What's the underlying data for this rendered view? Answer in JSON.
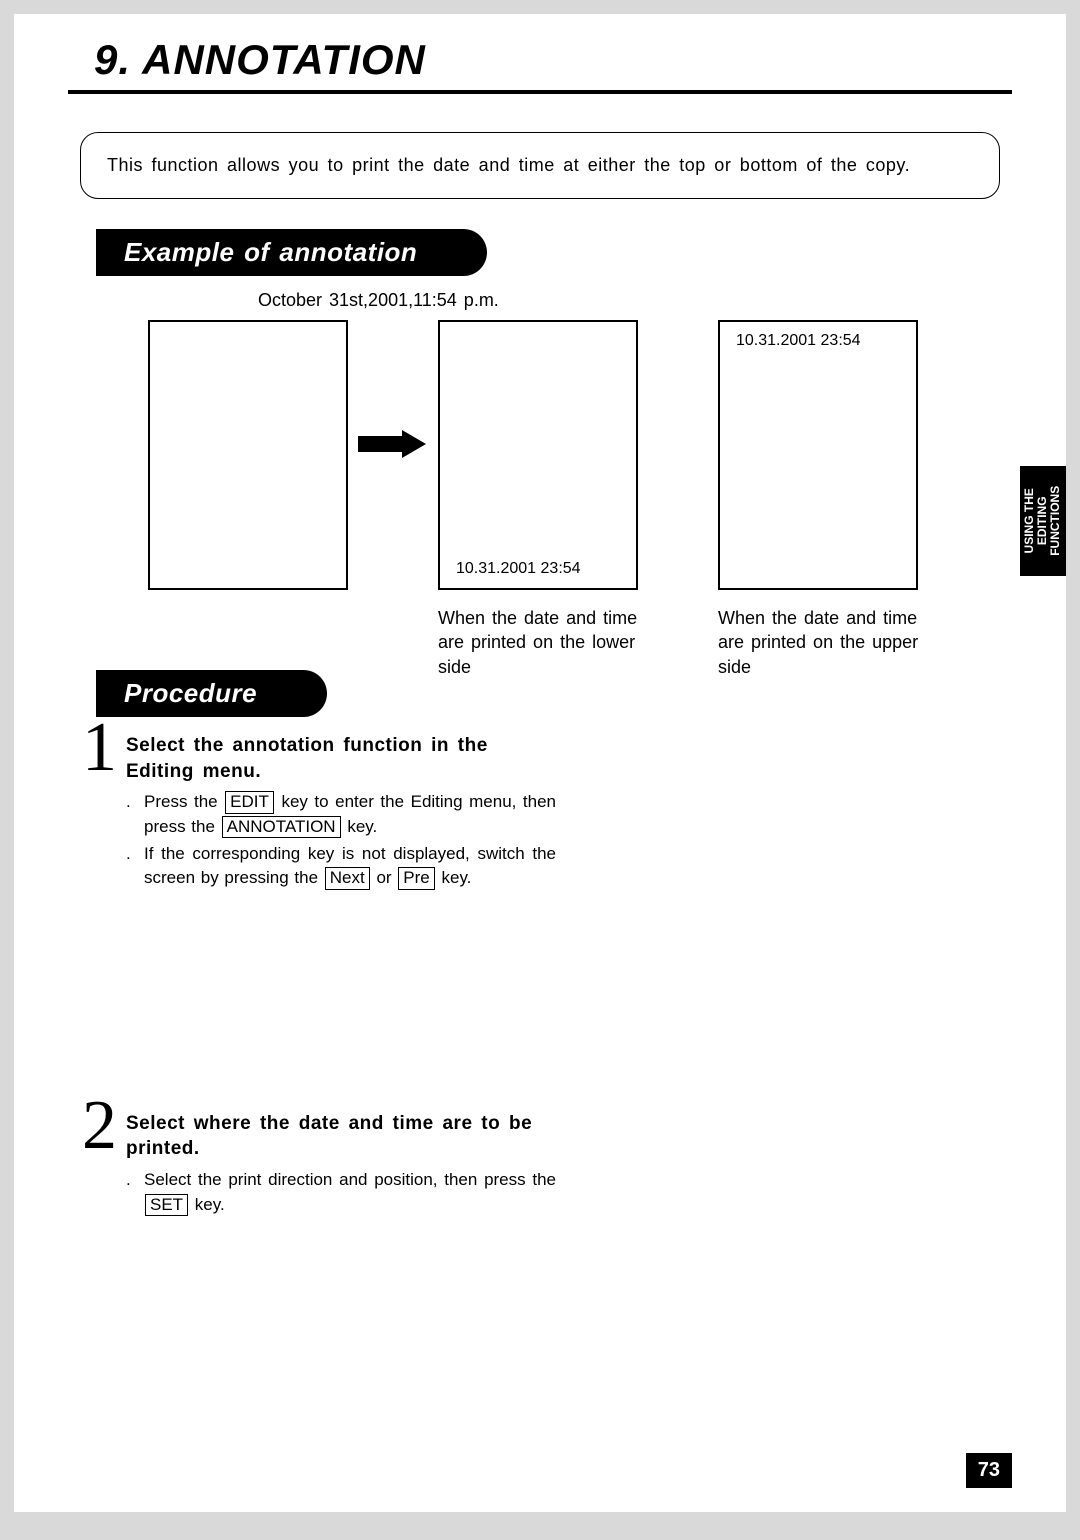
{
  "title": "9. ANNOTATION",
  "intro": "This function allows you to print the date and time at either the top or bottom of the copy.",
  "section_example": "Example of annotation",
  "date_label": "October 31st,2001,11:54 p.m.",
  "stamp": "10.31.2001 23:54",
  "caption_lower": "When the date and time are printed on the lower side",
  "caption_upper": "When the date and time are printed on the upper side",
  "side_tab_l1": "USING THE",
  "side_tab_l2": "EDITING",
  "side_tab_l3": "FUNCTIONS",
  "section_procedure": "Procedure",
  "step1": {
    "num": "1",
    "title": "Select the annotation function in the Editing menu.",
    "b1_a": "Press the ",
    "b1_key1": "EDIT",
    "b1_b": " key to enter the Editing menu, then press the ",
    "b1_key2": "ANNOTATION",
    "b1_c": " key.",
    "b2_a": "If the corresponding key is not displayed, switch the screen by pressing the ",
    "b2_key1": "Next",
    "b2_b": " or ",
    "b2_key2": "Pre",
    "b2_c": " key."
  },
  "step2": {
    "num": "2",
    "title": "Select where the date and time are to be printed.",
    "b1_a": "Select the print direction and position, then press the ",
    "b1_key1": "SET",
    "b1_b": " key."
  },
  "page_number": "73"
}
